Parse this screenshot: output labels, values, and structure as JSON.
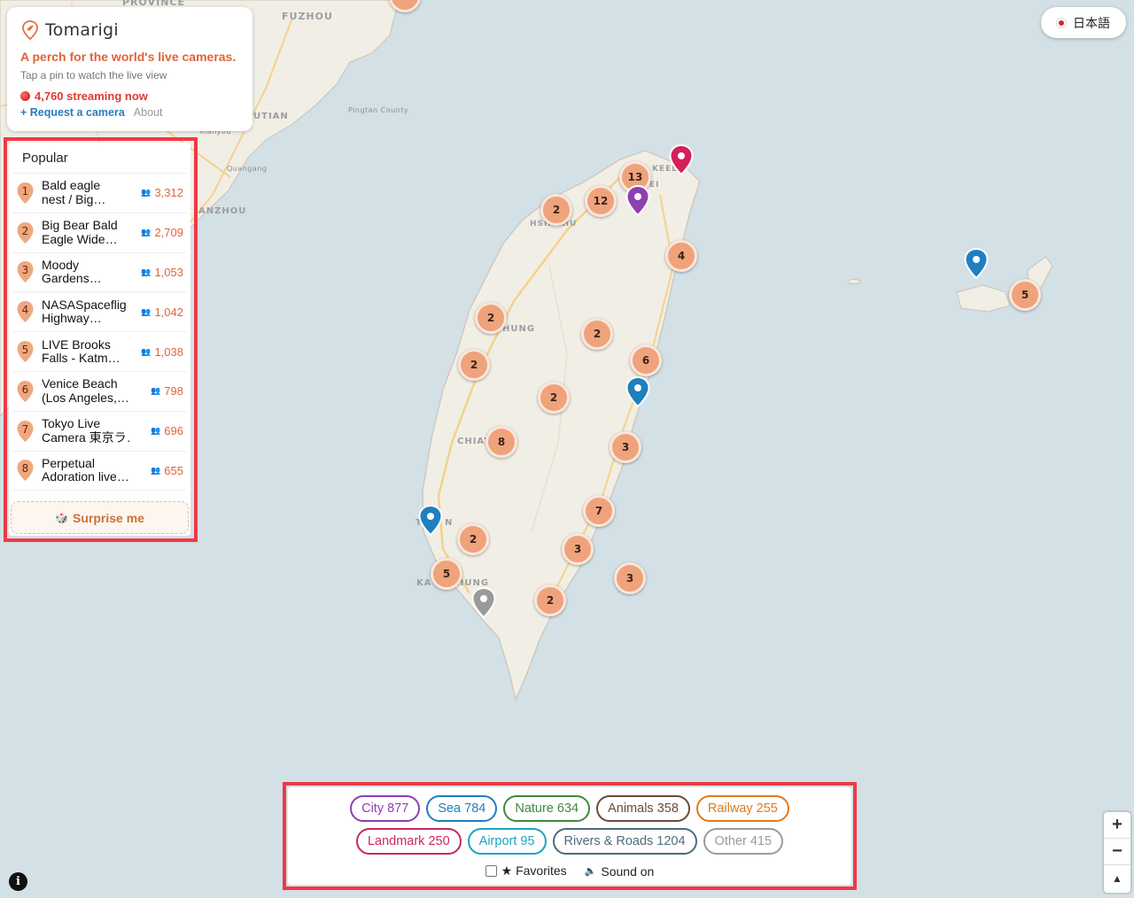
{
  "app": {
    "name": "Tomarigi",
    "tagline": "A perch for the world's live cameras.",
    "subtext": "Tap a pin to watch the live view",
    "streaming": "4,760 streaming now",
    "request_link": "+ Request a camera",
    "about_link": "About"
  },
  "language_button": "日本語",
  "popular": {
    "title": "Popular",
    "items": [
      {
        "rank": "1",
        "line1": "Bald eagle",
        "line2": "nest / Big…",
        "viewers": "3,312"
      },
      {
        "rank": "2",
        "line1": "Big Bear Bald",
        "line2": "Eagle Wide…",
        "viewers": "2,709"
      },
      {
        "rank": "3",
        "line1": "Moody",
        "line2": "Gardens…",
        "viewers": "1,053"
      },
      {
        "rank": "4",
        "line1": "NASASpaceflig",
        "line2": "Highway…",
        "viewers": "1,042"
      },
      {
        "rank": "5",
        "line1": "LIVE Brooks",
        "line2": "Falls - Katm…",
        "viewers": "1,038"
      },
      {
        "rank": "6",
        "line1": "Venice Beach",
        "line2": "(Los Angeles,…",
        "viewers": "798"
      },
      {
        "rank": "7",
        "line1": "Tokyo Live",
        "line2": "Camera 東京ラ…",
        "viewers": "696"
      },
      {
        "rank": "8",
        "line1": "Perpetual",
        "line2": "Adoration live…",
        "viewers": "655"
      }
    ],
    "surprise_label": "Surprise me"
  },
  "categories": {
    "row1": [
      {
        "label": "City 877",
        "color": "#8e3fb0"
      },
      {
        "label": "Sea 784",
        "color": "#1f7fbf"
      },
      {
        "label": "Nature 634",
        "color": "#3f8a3c"
      },
      {
        "label": "Animals 358",
        "color": "#6b4a3a"
      },
      {
        "label": "Railway 255",
        "color": "#e07a1f"
      }
    ],
    "row2": [
      {
        "label": "Landmark 250",
        "color": "#c8285e"
      },
      {
        "label": "Airport 95",
        "color": "#1ea3c2"
      },
      {
        "label": "Rivers & Roads 1204",
        "color": "#4e6b7c"
      },
      {
        "label": "Other 415",
        "color": "#9a9a9a"
      }
    ],
    "favorites_label": "★ Favorites",
    "sound_label": "Sound on"
  },
  "map": {
    "labels": [
      "PROVINCE",
      "FUZHOU",
      "Pingtan County",
      "Quangang",
      "UTIAN",
      "ANZHOU",
      "HSINCHU",
      "KEELU",
      "EI",
      "HUNG",
      "CHIAY",
      "T",
      "N",
      "KA",
      "HUNG",
      "Xianyou"
    ],
    "clusters": [
      "13",
      "12",
      "2",
      "4",
      "5",
      "2",
      "2",
      "2",
      "6",
      "2",
      "8",
      "3",
      "7",
      "2",
      "3",
      "5",
      "3",
      "2",
      "3"
    ],
    "pin_colors": {
      "landmark": "#d4205c",
      "city": "#8e3fb0",
      "sea": "#1f7fbf",
      "other": "#9a9a9a"
    }
  },
  "zoom": {
    "in": "+",
    "out": "−",
    "compass": "▲"
  },
  "info_button": "i"
}
